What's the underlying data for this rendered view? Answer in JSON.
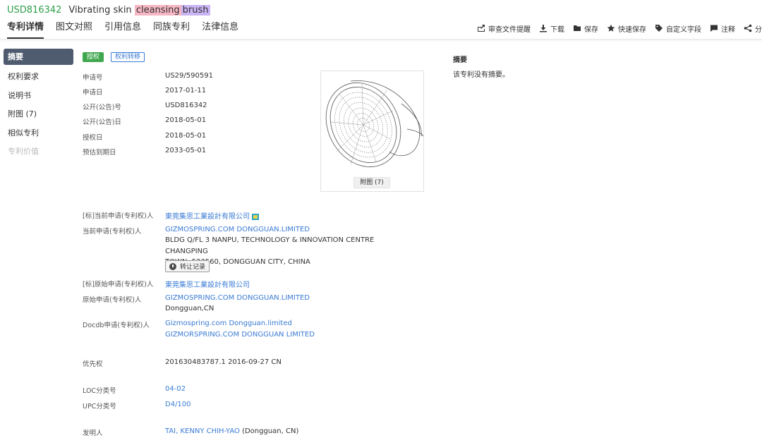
{
  "header": {
    "patent_number": "USD816342",
    "title_prefix": "Vibrating skin",
    "title_hl1": "cleansing",
    "title_hl2": "brush"
  },
  "tabs": [
    "专利详情",
    "图文对照",
    "引用信息",
    "同族专利",
    "法律信息"
  ],
  "toolbar": {
    "review_reminder": "审查文件提醒",
    "download": "下载",
    "save": "保存",
    "quick_save": "快速保存",
    "custom_field": "自定义字段",
    "annotate": "注释",
    "share": "分"
  },
  "nav": [
    "摘要",
    "权利要求",
    "说明书",
    "附图 (7)",
    "相似专利",
    "专利价值"
  ],
  "badges": {
    "grant": "授权",
    "transfer": "权利转移"
  },
  "details": {
    "app_no_label": "申请号",
    "app_no": "US29/590591",
    "app_date_label": "申请日",
    "app_date": "2017-01-11",
    "pub_no_label": "公开(公告)号",
    "pub_no": "USD816342",
    "pub_date_label": "公开(公告)日",
    "pub_date": "2018-05-01",
    "grant_date_label": "授权日",
    "grant_date": "2018-05-01",
    "expiry_label": "预估到期日",
    "expiry": "2033-05-01"
  },
  "image": {
    "button": "附图 (7)"
  },
  "assignees": {
    "std_current_label": "[标]当前申请(专利权)人",
    "std_current": "東莞集思工業設計有限公司",
    "current_label": "当前申请(专利权)人",
    "current": "GIZMOSPRING.COM DONGGUAN.LIMITED",
    "current_addr1": "BLDG Q/FL 3 NANPU, TECHNOLOGY & INNOVATION CENTRE CHANGPING",
    "current_addr2": "TOWN, 523560, DONGGUAN CITY, CHINA",
    "transfer_record": "转让记录",
    "std_orig_label": "[标]原始申请(专利权)人",
    "std_orig": "東莞集思工業設計有限公司",
    "orig_label": "原始申请(专利权)人",
    "orig": "GIZMOSPRING.COM DONGGUAN.LIMITED",
    "orig_loc": "Dongguan,CN",
    "docdb_label": "Docdb申请(专利权)人",
    "docdb1": "Gizmospring.com Dongguan.limited",
    "docdb2": "GIZMORSPRING.COM DONGGUAN LIMITED"
  },
  "priority": {
    "label": "优先权",
    "value": "201630483787.1 2016-09-27 CN"
  },
  "classification": {
    "loc_label": "LOC分类号",
    "loc": "04-02",
    "upc_label": "UPC分类号",
    "upc": "D4/100"
  },
  "inventor": {
    "label": "发明人",
    "name": "TAI, KENNY CHIH-YAO",
    "loc": "(Dongguan, CN)"
  },
  "abstract": {
    "title": "摘要",
    "text": "该专利没有摘要。"
  }
}
